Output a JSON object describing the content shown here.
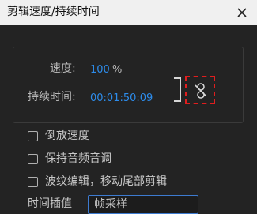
{
  "window": {
    "title": "剪辑速度/持续时间",
    "close_icon": "close-icon"
  },
  "speed": {
    "label": "速度:",
    "value": "100",
    "unit": "%"
  },
  "duration": {
    "label": "持续时间:",
    "value": "00:01:50:09"
  },
  "link": {
    "icon": "unlink-chain-icon",
    "highlight_color": "#e01e1e"
  },
  "options": [
    {
      "label": "倒放速度",
      "checked": false
    },
    {
      "label": "保持音频音调",
      "checked": false
    },
    {
      "label": "波纹编辑，移动尾部剪辑",
      "checked": false
    }
  ],
  "interpolation": {
    "label": "时间插值",
    "selected": "帧采样"
  },
  "colors": {
    "value_blue": "#2d8ceb",
    "background": "#232323"
  }
}
